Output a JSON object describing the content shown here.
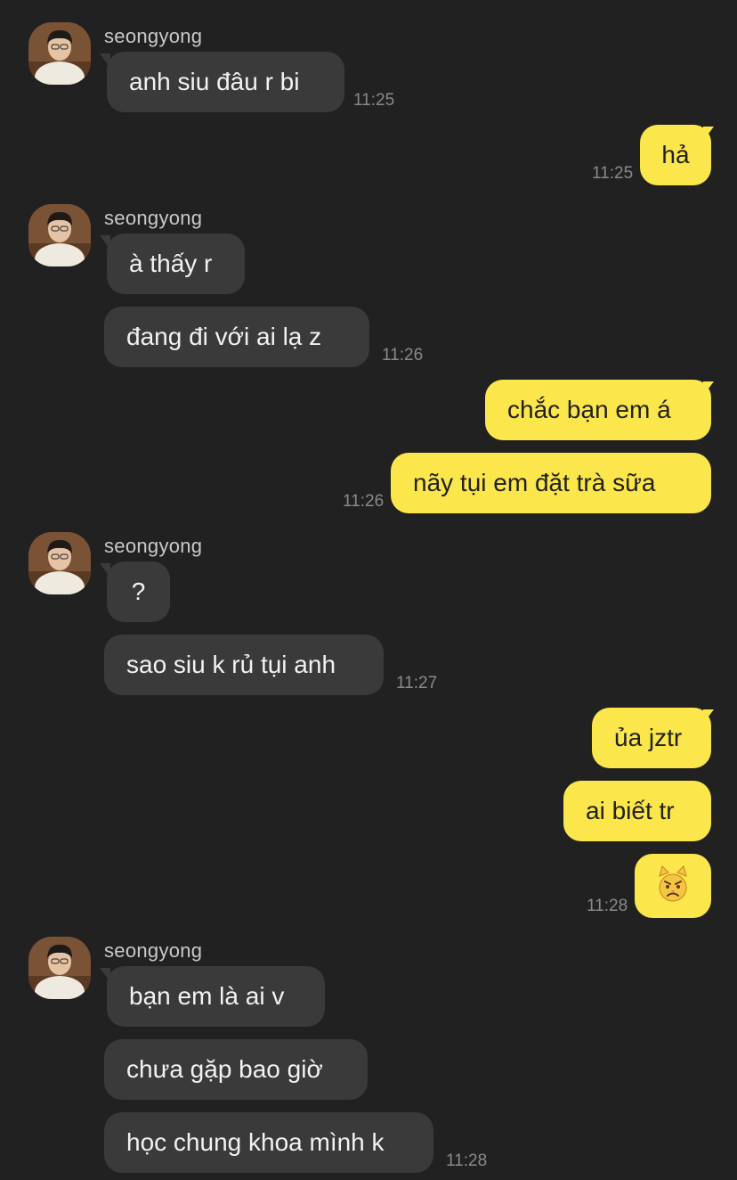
{
  "contact": {
    "name": "seongyong"
  },
  "messages": {
    "m1": "anh siu đâu r bi",
    "m2": "hả",
    "m3": "à thấy r",
    "m4": "đang đi với ai lạ z",
    "m5": "chắc bạn em á",
    "m6": "nãy tụi em đặt trà sữa",
    "m7": "?",
    "m8": "sao siu k rủ tụi anh",
    "m9": "ủa jztr",
    "m10": "ai biết tr",
    "m11_emoji": "angry-cat-emoji",
    "m12": "bạn em là ai v",
    "m13": "chưa gặp bao giờ",
    "m14": "học chung khoa mình k"
  },
  "times": {
    "t1": "11:25",
    "t2": "11:25",
    "t3": "11:26",
    "t4": "11:26",
    "t5": "11:27",
    "t6": "11:28",
    "t7": "11:28"
  },
  "colors": {
    "background": "#212121",
    "incoming_bubble": "#3a3a3a",
    "outgoing_bubble": "#fbe74b",
    "timestamp": "#8a8a8a",
    "sender_name": "#c9c9c9"
  }
}
